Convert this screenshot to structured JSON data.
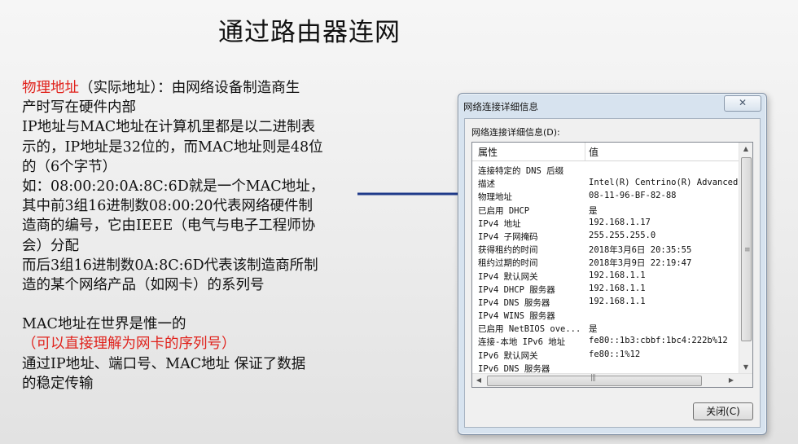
{
  "slide": {
    "title": "通过路由器连网",
    "lines": {
      "l1_red": "物理地址",
      "l1_rest": "（实际地址）：由网络设备制造商生",
      "l2": "产时写在硬件内部",
      "l3": "IP地址与MAC地址在计算机里都是以二进制表",
      "l4": "示的，IP地址是32位的，而MAC地址则是48位",
      "l5": "的（6个字节）",
      "l6": "如：08:00:20:0A:8C:6D就是一个MAC地址，",
      "l7": "其中前3组16进制数08:00:20代表网络硬件制",
      "l8": "造商的编号，它由IEEE（电气与电子工程师协",
      "l9": "会）分配",
      "l10": "而后3组16进制数0A:8C:6D代表该制造商所制",
      "l11": "造的某个网络产品（如网卡）的系列号",
      "l12": "MAC地址在世界是惟一的",
      "l13_red": "（可以直接理解为网卡的序列号）",
      "l14": "通过IP地址、端口号、MAC地址   保证了数据",
      "l15": "的稳定传输"
    }
  },
  "dialog": {
    "title": "网络连接详细信息",
    "close_icon": "✕",
    "list_label": "网络连接详细信息(D):",
    "columns": {
      "property": "属性",
      "value": "值"
    },
    "rows": [
      {
        "k": "连接特定的 DNS 后缀",
        "v": ""
      },
      {
        "k": "描述",
        "v": "Intel(R) Centrino(R) Advanced-"
      },
      {
        "k": "物理地址",
        "v": "08-11-96-BF-82-88"
      },
      {
        "k": "已启用 DHCP",
        "v": "是"
      },
      {
        "k": "IPv4 地址",
        "v": "192.168.1.17"
      },
      {
        "k": "IPv4 子网掩码",
        "v": "255.255.255.0"
      },
      {
        "k": "获得租约的时间",
        "v": "2018年3月6日 20:35:55"
      },
      {
        "k": "租约过期的时间",
        "v": "2018年3月9日 22:19:47"
      },
      {
        "k": "IPv4 默认网关",
        "v": "192.168.1.1"
      },
      {
        "k": "IPv4 DHCP 服务器",
        "v": "192.168.1.1"
      },
      {
        "k": "IPv4 DNS 服务器",
        "v": "192.168.1.1"
      },
      {
        "k": "IPv4 WINS 服务器",
        "v": ""
      },
      {
        "k": "已启用 NetBIOS ove...",
        "v": "是"
      },
      {
        "k": "连接-本地 IPv6 地址",
        "v": "fe80::1b3:cbbf:1bc4:222b%12"
      },
      {
        "k": "IPv6 默认网关",
        "v": "fe80::1%12"
      },
      {
        "k": "IPv6 DNS 服务器",
        "v": ""
      }
    ],
    "close_button": "关闭(C)"
  }
}
